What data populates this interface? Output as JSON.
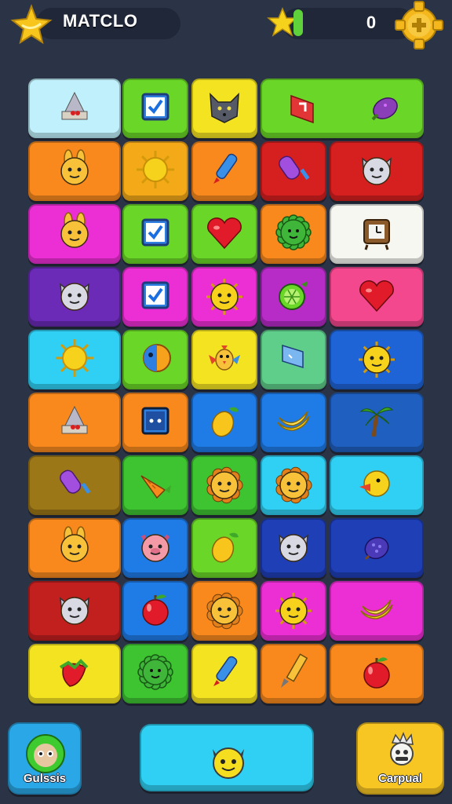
{
  "header": {
    "title": "MATCLO",
    "score": "0",
    "logo_icon": "banana-star-icon",
    "score_icon": "star-icon",
    "settings_icon": "gear-icon"
  },
  "colors": {
    "background": "#2b3446",
    "pill": "#1f2738",
    "score_bar": "#5fd13a",
    "settings": "#f5b81c"
  },
  "grid": {
    "rows": [
      [
        {
          "icon": "cake-slice-icon",
          "color": "#bff0fb"
        },
        {
          "icon": "checkbox-icon",
          "color": "#6ad627"
        },
        {
          "icon": "wolf-icon",
          "color": "#f4e321"
        },
        {
          "icon": "flag-icon",
          "icon2": "eggplant-icon",
          "color": "#6ad627",
          "wide": true
        }
      ],
      [
        {
          "icon": "bunny-icon",
          "color": "#f9891d"
        },
        {
          "icon": "sun-icon",
          "color": "#f4a919"
        },
        {
          "icon": "marker-icon",
          "color": "#f9891d"
        },
        {
          "icon": "popsicle-icon",
          "color": "#d61f1f"
        },
        {
          "icon": "cat-icon",
          "color": "#d61f1f"
        }
      ],
      [
        {
          "icon": "bunny-icon",
          "color": "#ec2fd4"
        },
        {
          "icon": "checkbox-icon",
          "color": "#6ad627"
        },
        {
          "icon": "heart-icon",
          "color": "#6ad627"
        },
        {
          "icon": "spiky-ball-icon",
          "color": "#f9891d"
        },
        {
          "icon": "cuckoo-clock-icon",
          "color": "#f7f7f2"
        }
      ],
      [
        {
          "icon": "cat-icon",
          "color": "#6b2bb7"
        },
        {
          "icon": "checkbox-icon",
          "color": "#ec2fd4"
        },
        {
          "icon": "sun-face-icon",
          "color": "#ec2fd4"
        },
        {
          "icon": "lime-icon",
          "color": "#b72bc7"
        },
        {
          "icon": "heart-icon",
          "color": "#f3478e"
        }
      ],
      [
        {
          "icon": "sun-icon",
          "color": "#2fd0f4"
        },
        {
          "icon": "orange-half-icon",
          "color": "#6ad627"
        },
        {
          "icon": "bird-icon",
          "color": "#f4e321"
        },
        {
          "icon": "laptop-icon",
          "color": "#5fce8a"
        },
        {
          "icon": "sun-face-icon",
          "color": "#1f64d6"
        }
      ],
      [
        {
          "icon": "cake-slice-icon",
          "color": "#f9891d"
        },
        {
          "icon": "block-face-icon",
          "color": "#f9891d"
        },
        {
          "icon": "mango-icon",
          "color": "#1f7be6"
        },
        {
          "icon": "banana-icon",
          "color": "#1f7be6"
        },
        {
          "icon": "palm-tree-icon",
          "color": "#1f5fbf"
        }
      ],
      [
        {
          "icon": "popsicle-icon",
          "color": "#9c7717"
        },
        {
          "icon": "carrot-icon",
          "color": "#3ec331"
        },
        {
          "icon": "lion-icon",
          "color": "#3ec331"
        },
        {
          "icon": "lion-icon",
          "color": "#2fd0f4"
        },
        {
          "icon": "duck-icon",
          "color": "#2fd0f4"
        }
      ],
      [
        {
          "icon": "bunny-icon",
          "color": "#f9891d"
        },
        {
          "icon": "pig-icon",
          "color": "#1f7be6"
        },
        {
          "icon": "mango-icon",
          "color": "#6ad627"
        },
        {
          "icon": "cat-icon",
          "color": "#1f3fb7"
        },
        {
          "icon": "plum-icon",
          "color": "#1f3fb7"
        }
      ],
      [
        {
          "icon": "cat-icon",
          "color": "#c21f1f"
        },
        {
          "icon": "apple-icon",
          "color": "#1f7be6"
        },
        {
          "icon": "lion-icon",
          "color": "#f9891d"
        },
        {
          "icon": "sun-face-icon",
          "color": "#ec2fd4"
        },
        {
          "icon": "banana-icon",
          "color": "#ec2fd4"
        }
      ],
      [
        {
          "icon": "strawberry-icon",
          "color": "#f4e321"
        },
        {
          "icon": "spiky-ball-icon",
          "color": "#3ec331"
        },
        {
          "icon": "marker-icon",
          "color": "#f4e321"
        },
        {
          "icon": "pencil-icon",
          "color": "#f9891d"
        },
        {
          "icon": "apple-icon",
          "color": "#f9891d"
        }
      ]
    ]
  },
  "footer": {
    "left": {
      "label": "Gulssis",
      "icon": "alien-face-icon",
      "color": "#2aa7e6"
    },
    "middle": {
      "icon": "cat-face-icon",
      "color": "#2fd0f4"
    },
    "right": {
      "label": "Carpual",
      "icon": "clown-icon",
      "color": "#f8c623"
    }
  }
}
